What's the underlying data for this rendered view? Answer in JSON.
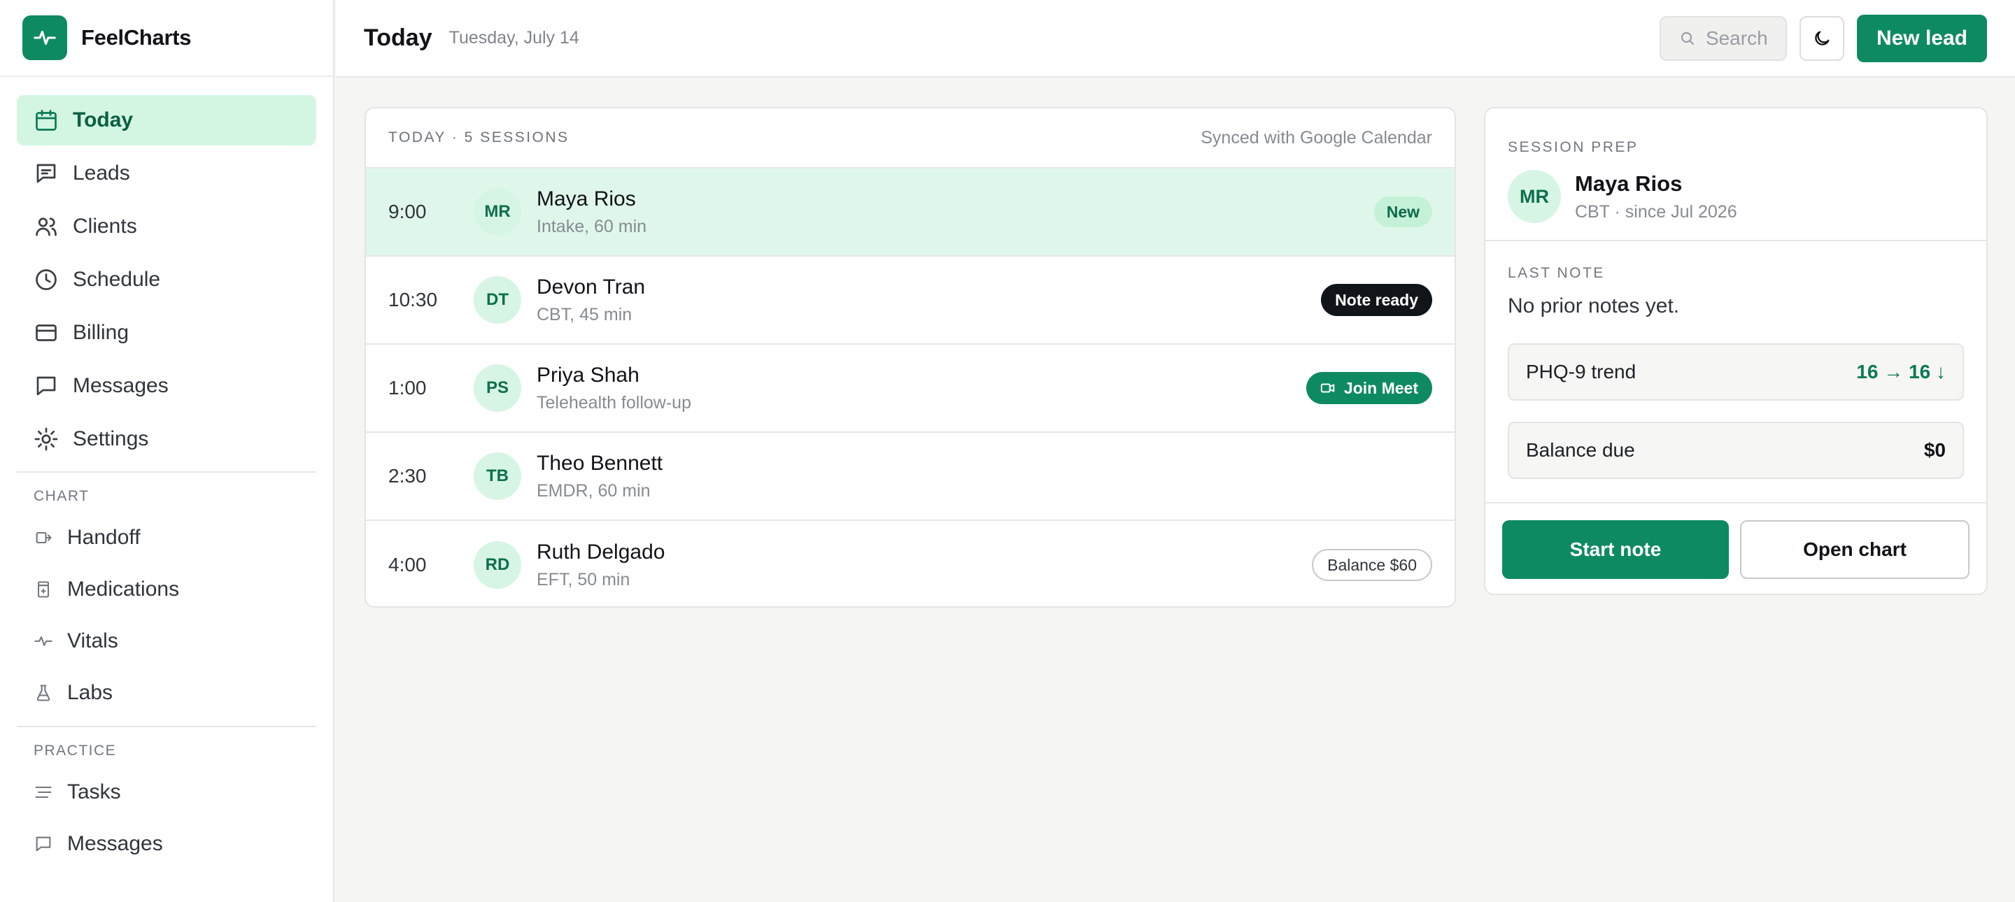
{
  "app": {
    "name": "FeelCharts",
    "logo_icon": "pulse-icon",
    "accent": "#0e8a62"
  },
  "sidebar": {
    "items": [
      {
        "label": "Today",
        "icon": "calendar-icon",
        "active": true
      },
      {
        "label": "Leads",
        "icon": "chat-lines-icon"
      },
      {
        "label": "Clients",
        "icon": "users-icon"
      },
      {
        "label": "Schedule",
        "icon": "clock-icon"
      },
      {
        "label": "Billing",
        "icon": "card-icon"
      },
      {
        "label": "Messages",
        "icon": "message-icon"
      },
      {
        "label": "Settings",
        "icon": "gear-icon"
      }
    ],
    "chart_section": {
      "label": "CHART",
      "items": [
        {
          "label": "Handoff",
          "icon": "handoff-icon"
        },
        {
          "label": "Medications",
          "icon": "pill-bottle-icon"
        },
        {
          "label": "Vitals",
          "icon": "pulse-icon"
        },
        {
          "label": "Labs",
          "icon": "flask-icon"
        }
      ]
    },
    "practice_section": {
      "label": "PRACTICE",
      "items": [
        {
          "label": "Tasks",
          "icon": "tasks-icon"
        },
        {
          "label": "Messages",
          "icon": "message-icon"
        }
      ]
    }
  },
  "header": {
    "title": "Today",
    "date": "Tuesday, July 14",
    "search_placeholder": "Search",
    "new_lead_label": "New lead"
  },
  "sessions": {
    "title": "TODAY · 5 SESSIONS",
    "sync_status": "Synced with Google Calendar",
    "rows": [
      {
        "time": "9:00",
        "initials": "MR",
        "name": "Maya Rios",
        "detail": "Intake, 60 min",
        "badge": "New",
        "badge_type": "new",
        "selected": true
      },
      {
        "time": "10:30",
        "initials": "DT",
        "name": "Devon Tran",
        "detail": "CBT, 45 min",
        "badge": "Note ready",
        "badge_type": "dark"
      },
      {
        "time": "1:00",
        "initials": "PS",
        "name": "Priya Shah",
        "detail": "Telehealth follow-up",
        "badge": "Join Meet",
        "badge_type": "green",
        "badge_icon": "video-icon"
      },
      {
        "time": "2:30",
        "initials": "TB",
        "name": "Theo Bennett",
        "detail": "EMDR, 60 min",
        "badge": ""
      },
      {
        "time": "4:00",
        "initials": "RD",
        "name": "Ruth Delgado",
        "detail": "EFT, 50 min",
        "badge": "Balance $60",
        "badge_type": "outline"
      }
    ]
  },
  "prep": {
    "label": "SESSION PREP",
    "client_initials": "MR",
    "client_name": "Maya Rios",
    "client_meta": "CBT · since Jul 2026",
    "last_note_label": "LAST NOTE",
    "last_note": "No prior notes yet.",
    "trend_label": "PHQ-9 trend",
    "trend_value": "16 → 16 ↓",
    "balance_label": "Balance due",
    "balance_value": "$0",
    "start_note_label": "Start note",
    "open_chart_label": "Open chart"
  }
}
